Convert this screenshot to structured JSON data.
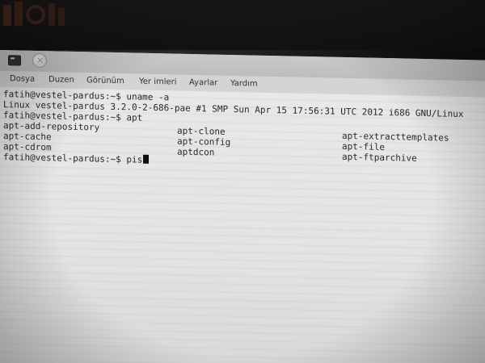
{
  "desktop": {
    "logo_text": "Vestel"
  },
  "window": {
    "titlebar": {
      "terminal_icon": "terminal-icon",
      "close_icon": "close-icon",
      "close_glyph": "×"
    },
    "menu": [
      "Dosya",
      "Duzen",
      "Görünüm",
      "Yer imleri",
      "Ayarlar",
      "Yardım"
    ]
  },
  "terminal": {
    "prompt": "fatih@vestel-pardus:~$",
    "lines": [
      {
        "text": "fatih@vestel-pardus:~$ uname -a"
      },
      {
        "text": "Linux vestel-pardus 3.2.0-2-686-pae #1 SMP Sun Apr 15 17:56:31 UTC 2012 i686 GNU/Linux"
      },
      {
        "text": "fatih@vestel-pardus:~$ apt"
      }
    ],
    "completions": {
      "col1": [
        "apt-add-repository",
        "apt-cache",
        "apt-cdrom"
      ],
      "col2": [
        "apt-clone",
        "apt-config",
        "aptdcon"
      ],
      "col3": [
        "apt-extracttemplates",
        "apt-file",
        "apt-ftparchive"
      ]
    },
    "current_input": "fatih@vestel-pardus:~$ pis"
  }
}
